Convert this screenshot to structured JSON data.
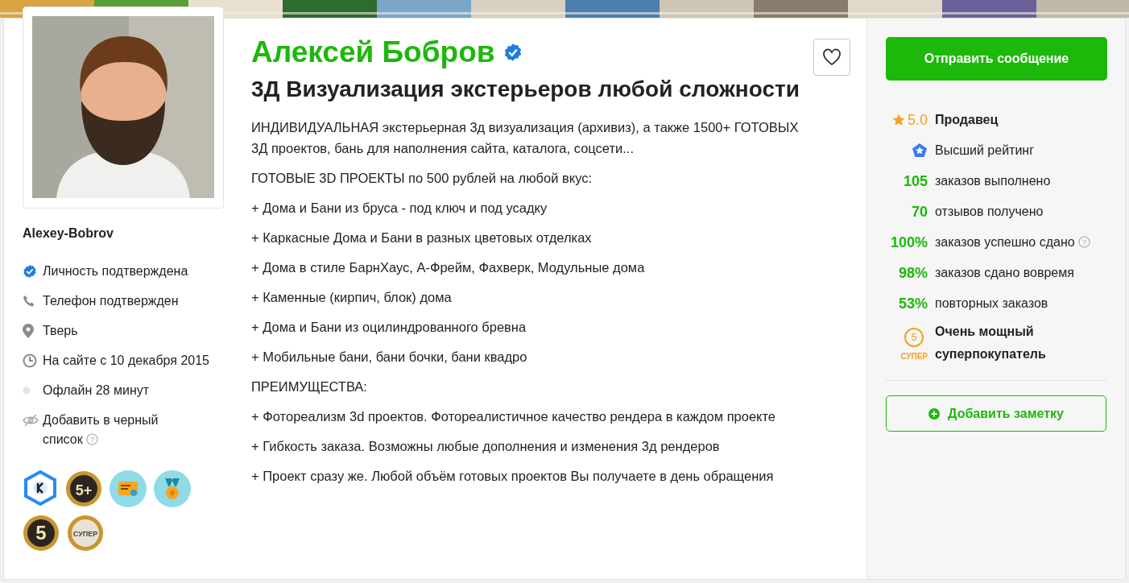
{
  "profile": {
    "username": "Alexey-Bobrov",
    "info": [
      {
        "kind": "verified",
        "text": "Личность подтверждена"
      },
      {
        "kind": "phone",
        "text": "Телефон подтвержден"
      },
      {
        "kind": "pin",
        "text": "Тверь"
      },
      {
        "kind": "clock",
        "text": "На сайте с 10 декабря 2015"
      },
      {
        "kind": "dot",
        "text": "Офлайн 28 минут"
      },
      {
        "kind": "hidden",
        "text": "Добавить в черный список",
        "help": "?"
      }
    ],
    "badges": [
      {
        "kind": "hexagon"
      },
      {
        "kind": "gold",
        "text": "5+"
      },
      {
        "kind": "certificate"
      },
      {
        "kind": "medal"
      },
      {
        "kind": "gold",
        "text": "5"
      },
      {
        "kind": "silver",
        "text": "СУПЕР"
      }
    ]
  },
  "main": {
    "name": "Алексей Бобров",
    "verified": true,
    "favorite": false,
    "title": "3Д Визуализация экстерьеров любой сложности",
    "paragraphs": [
      "ИНДИВИДУАЛЬНАЯ экстерьерная 3д визуализация (архивиз), а также 1500+ ГОТОВЫХ 3Д проектов, бань для наполнения сайта, каталога, соцсети...",
      "ГОТОВЫЕ 3D ПРОЕКТЫ по 500 рублей на любой вкус:",
      "+ Дома и Бани из бруса - под ключ и под усадку",
      "+ Каркасные Дома и Бани в разных цветовых отделках",
      "+ Дома в стиле БарнХаус, А-Фрейм, Фахверк, Модульные дома",
      "+ Каменные (кирпич, блок) дома",
      "+ Дома и Бани из оцилиндрованного бревна",
      "+ Мобильные бани, бани бочки, бани квадро",
      "ПРЕИМУЩЕСТВА:",
      "+ Фотореализм 3d проектов. Фотореалистичное качество рендера в каждом проекте",
      "+ Гибкость заказа. Возможны любые дополнения и изменения 3д рендеров",
      "+ Проект сразу же. Любой объём готовых проектов Вы получаете в день обращения"
    ]
  },
  "sidebar": {
    "message_button": "Отправить сообщение",
    "rating": {
      "value": "5.0",
      "label": "Продавец"
    },
    "top_rating": {
      "label": "Высший рейтинг"
    },
    "stats": [
      {
        "value": "105",
        "label": "заказов выполнено"
      },
      {
        "value": "70",
        "label": "отзывов получено"
      },
      {
        "value": "100%",
        "label": "заказов успешно сдано",
        "help": "?"
      },
      {
        "value": "98%",
        "label": "заказов сдано вовремя"
      },
      {
        "value": "53%",
        "label": "повторных заказов"
      }
    ],
    "level": {
      "number": "5",
      "tag": "СУПЕР",
      "label": "Очень мощный суперпокупатель"
    },
    "note_button": "Добавить заметку"
  }
}
